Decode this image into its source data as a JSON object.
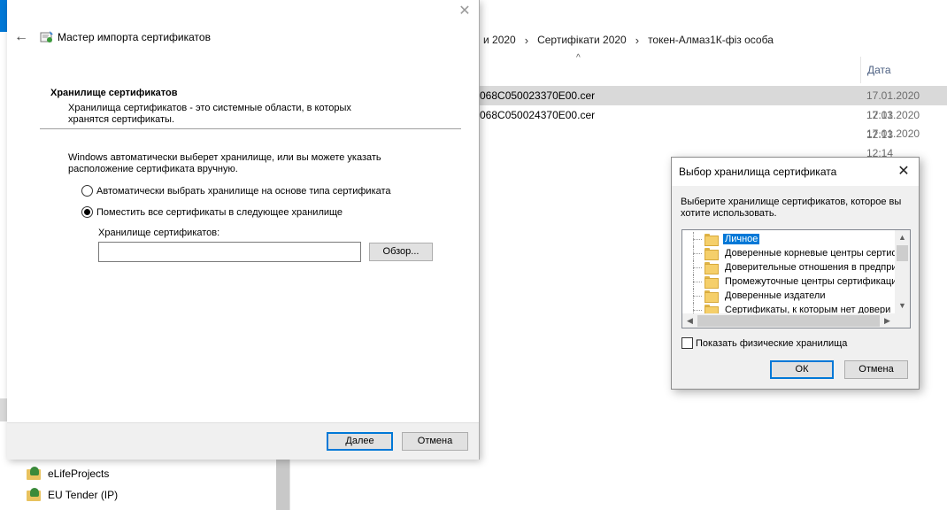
{
  "explorer": {
    "breadcrumb": [
      "и 2020",
      "Сертифікати 2020",
      "токен-Алмаз1К-фіз особа"
    ],
    "sort_indicator": "^",
    "column_date_header": "Дата изменения",
    "files": [
      {
        "name": "068C050023370E00.cer",
        "date": "17.01.2020 12:13"
      },
      {
        "name": "068C050024370E00.cer",
        "date": "17.01.2020 12:13"
      },
      {
        "name": "",
        "date": "17.01.2020 12:14"
      }
    ],
    "nav_items": [
      "eLifeProjects",
      "EU Tender (IP)"
    ],
    "colors": {
      "selected_row": "#d9d9d9",
      "date_header": "#4d6082",
      "accent": "#0078d7"
    }
  },
  "wizard": {
    "close_glyph": "✕",
    "back_glyph": "←",
    "title": "Мастер импорта сертификатов",
    "section_title": "Хранилище сертификатов",
    "section_desc": "Хранилища сертификатов - это системные области, в которых хранятся сертификаты.",
    "info_text": "Windows автоматически выберет хранилище, или вы можете указать расположение сертификата вручную.",
    "radio_auto": "Автоматически выбрать хранилище на основе типа сертификата",
    "radio_manual": "Поместить все сертификаты в следующее хранилище",
    "store_label": "Хранилище сертификатов:",
    "store_value": "",
    "browse_label": "Обзор...",
    "next_label": "Далее",
    "cancel_label": "Отмена"
  },
  "dialog": {
    "title": "Выбор хранилища сертификата",
    "close_glyph": "✕",
    "description": "Выберите хранилище сертификатов, которое вы хотите использовать.",
    "stores": [
      "Личное",
      "Доверенные корневые центры сертиф",
      "Доверительные отношения в предприя",
      "Промежуточные центры сертификаци",
      "Доверенные издатели",
      "Сертификаты, к которым нет довери"
    ],
    "selected_store_index": 0,
    "show_physical_label": "Показать физические хранилища",
    "show_physical_checked": false,
    "ok_label": "ОК",
    "cancel_label": "Отмена"
  }
}
